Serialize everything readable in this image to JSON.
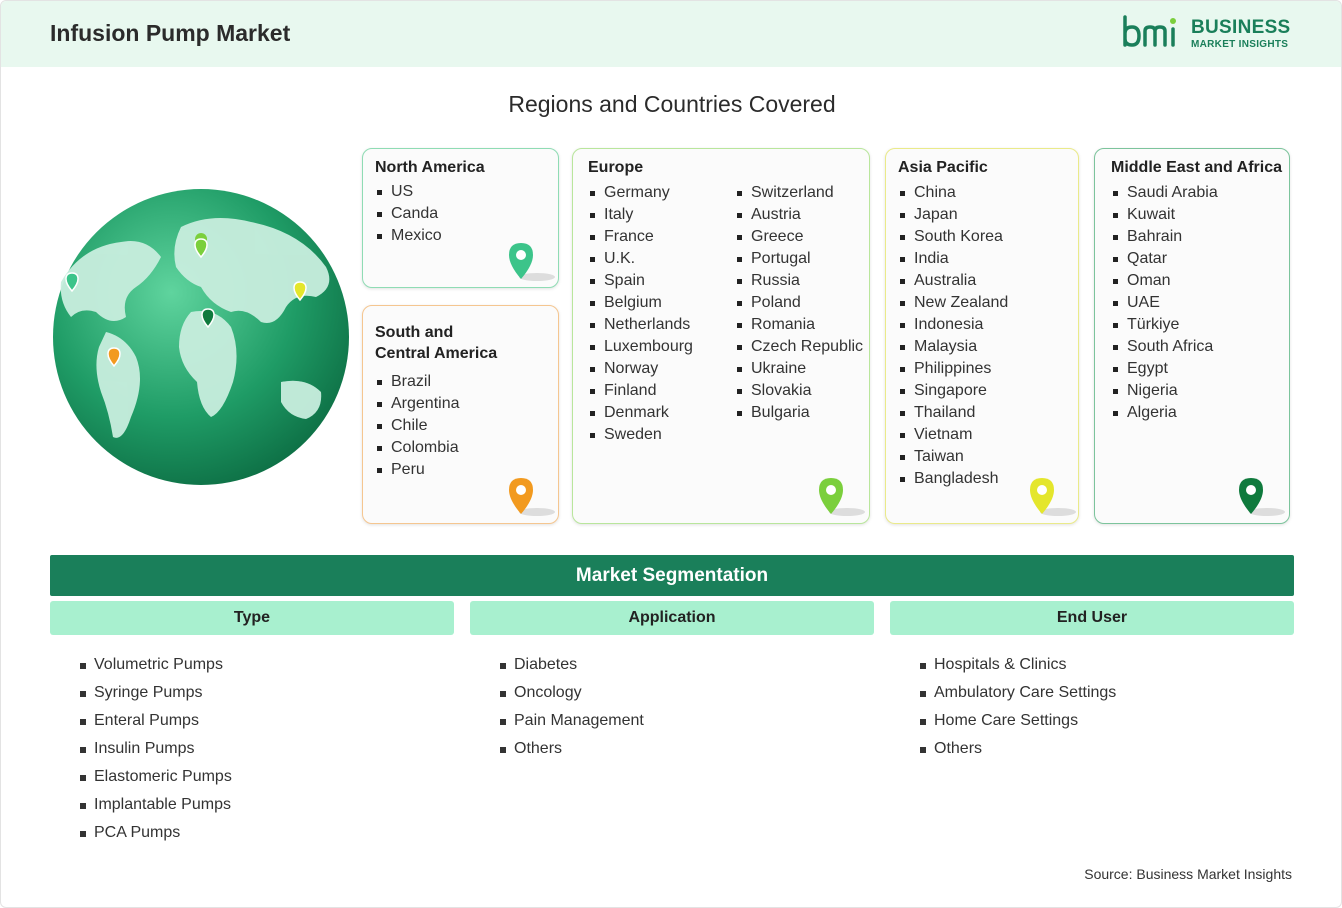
{
  "header": {
    "title": "Infusion Pump Market"
  },
  "logo": {
    "line1": "BUSINESS",
    "line2": "MARKET INSIGHTS"
  },
  "regions_title": "Regions and Countries Covered",
  "regions": {
    "north_america": {
      "title": "North America",
      "countries": [
        "US",
        "Canda",
        "Mexico"
      ],
      "pin_color": "#3cc48a"
    },
    "south_central_america": {
      "title": "South and Central America",
      "countries": [
        "Brazil",
        "Argentina",
        "Chile",
        "Colombia",
        "Peru"
      ],
      "pin_color": "#f29a1f"
    },
    "europe": {
      "title": "Europe",
      "countries_col1": [
        "Germany",
        "Italy",
        "France",
        "U.K.",
        "Spain",
        "Belgium",
        "Netherlands",
        "Luxembourg",
        "Norway",
        "Finland",
        "Denmark",
        "Sweden"
      ],
      "countries_col2": [
        "Switzerland",
        "Austria",
        "Greece",
        "Portugal",
        "Russia",
        "Poland",
        "Romania",
        "Czech Republic",
        "Ukraine",
        "Slovakia",
        "Bulgaria"
      ],
      "pin_color": "#7bcf3c"
    },
    "asia_pacific": {
      "title": "Asia Pacific",
      "countries": [
        "China",
        "Japan",
        "South Korea",
        "India",
        "Australia",
        "New Zealand",
        "Indonesia",
        "Malaysia",
        "Philippines",
        "Singapore",
        "Thailand",
        "Vietnam",
        "Taiwan",
        "Bangladesh"
      ],
      "pin_color": "#e4e62c"
    },
    "middle_east_africa": {
      "title": "Middle East and Africa",
      "countries": [
        "Saudi Arabia",
        "Kuwait",
        "Bahrain",
        "Qatar",
        "Oman",
        "UAE",
        "Türkiye",
        "South Africa",
        "Egypt",
        "Nigeria",
        "Algeria"
      ],
      "pin_color": "#0f7a3d"
    }
  },
  "segmentation": {
    "title": "Market Segmentation",
    "type": {
      "label": "Type",
      "items": [
        "Volumetric Pumps",
        "Syringe Pumps",
        "Enteral Pumps",
        "Insulin Pumps",
        "Elastomeric Pumps",
        "Implantable Pumps",
        "PCA Pumps"
      ]
    },
    "application": {
      "label": "Application",
      "items": [
        "Diabetes",
        "Oncology",
        "Pain Management",
        "Others"
      ]
    },
    "end_user": {
      "label": "End User",
      "items": [
        "Hospitals & Clinics",
        "Ambulatory Care Settings",
        "Home Care Settings",
        "Others"
      ]
    }
  },
  "source": "Source: Business Market Insights",
  "colors": {
    "accent": "#1a7f5a",
    "header_bg": "#e8f8ef",
    "segment_head_bg": "#a8f0cf"
  }
}
